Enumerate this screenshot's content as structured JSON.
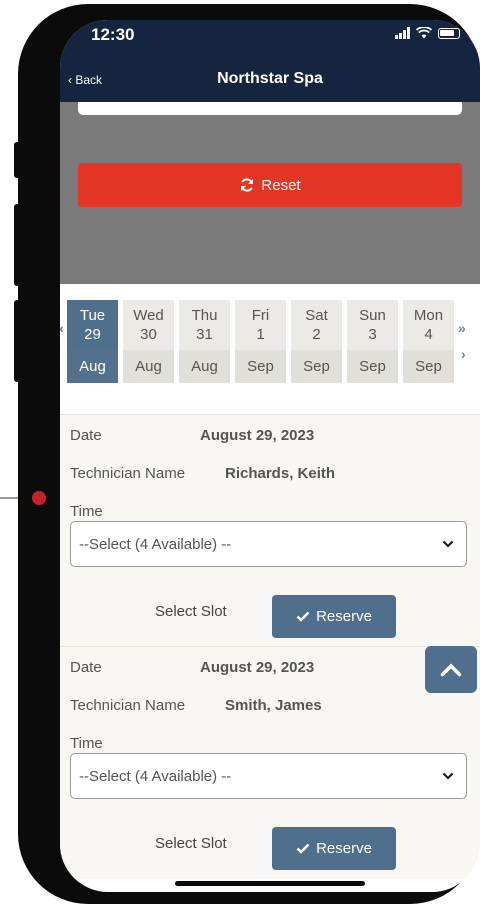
{
  "status": {
    "time": "12:30"
  },
  "header": {
    "back_label": "Back",
    "title": "Northstar Spa"
  },
  "reset": {
    "label": "Reset",
    "icon": "refresh-icon"
  },
  "date_nav": {
    "prev_week": "«",
    "prev": "‹",
    "next_week": "»",
    "next": "›"
  },
  "days": [
    {
      "weekday": "Tue",
      "day": "29",
      "month": "Aug",
      "selected": true
    },
    {
      "weekday": "Wed",
      "day": "30",
      "month": "Aug",
      "selected": false
    },
    {
      "weekday": "Thu",
      "day": "31",
      "month": "Aug",
      "selected": false
    },
    {
      "weekday": "Fri",
      "day": "1",
      "month": "Sep",
      "selected": false
    },
    {
      "weekday": "Sat",
      "day": "2",
      "month": "Sep",
      "selected": false
    },
    {
      "weekday": "Sun",
      "day": "3",
      "month": "Sep",
      "selected": false
    },
    {
      "weekday": "Mon",
      "day": "4",
      "month": "Sep",
      "selected": false
    }
  ],
  "slots": [
    {
      "date_label": "Date",
      "date_value": "August 29, 2023",
      "tech_label": "Technician Name",
      "tech_value": "Richards, Keith",
      "time_label": "Time",
      "time_select": "--Select (4 Available) --",
      "slot_label": "Select Slot",
      "reserve_label": "Reserve"
    },
    {
      "date_label": "Date",
      "date_value": "August 29, 2023",
      "tech_label": "Technician Name",
      "tech_value": "Smith, James",
      "time_label": "Time",
      "time_select": "--Select (4 Available) --",
      "slot_label": "Select Slot",
      "reserve_label": "Reserve"
    }
  ],
  "colors": {
    "header": "#15253f",
    "reset": "#e43525",
    "accent": "#4f6f8d",
    "marker": "#c5222d"
  }
}
